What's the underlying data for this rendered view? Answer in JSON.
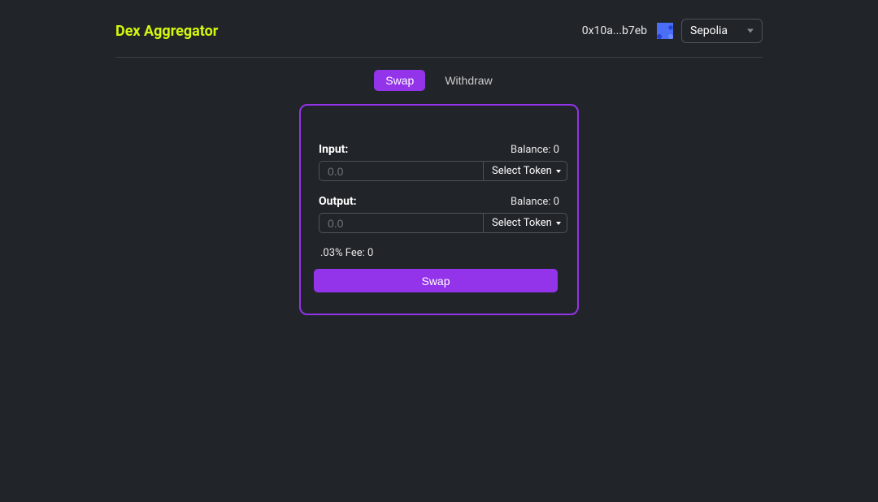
{
  "header": {
    "brand": "Dex Aggregator",
    "address": "0x10a...b7eb",
    "network": "Sepolia"
  },
  "tabs": {
    "swap": "Swap",
    "withdraw": "Withdraw"
  },
  "swap": {
    "input_label": "Input:",
    "input_balance": "Balance: 0",
    "input_placeholder": "0.0",
    "input_token_label": "Select Token",
    "output_label": "Output:",
    "output_balance": "Balance: 0",
    "output_placeholder": "0.0",
    "output_token_label": "Select Token",
    "fee_text": ".03% Fee: 0",
    "button_label": "Swap"
  }
}
